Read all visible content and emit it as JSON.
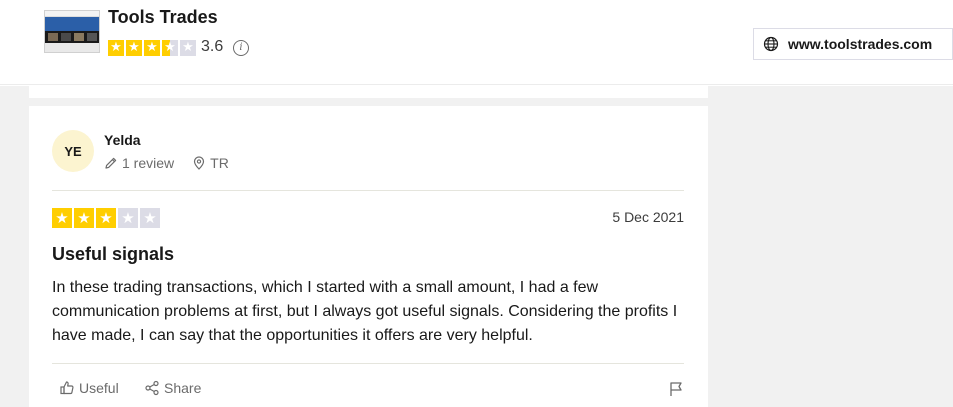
{
  "company": {
    "name": "Tools Trades",
    "rating": "3.6",
    "stars_filled": 3.5,
    "website": "www.toolstrades.com",
    "star_color": "#ffce00"
  },
  "review": {
    "avatar_initials": "YE",
    "avatar_color": "#fcf4d0",
    "reviewer_name": "Yelda",
    "review_count": "1 review",
    "country": "TR",
    "stars": 3,
    "date": "5 Dec 2021",
    "title": "Useful signals",
    "body": "In these trading transactions, which I started with a small amount, I had a few communication problems at first, but I always got useful signals. Considering the profits I have made, I can say that the opportunities it offers are very helpful.",
    "actions": {
      "useful_label": "Useful",
      "share_label": "Share"
    }
  },
  "icons": [
    "info-icon",
    "globe-icon",
    "pencil-icon",
    "location-pin-icon",
    "thumbs-up-icon",
    "share-icon",
    "flag-icon"
  ]
}
